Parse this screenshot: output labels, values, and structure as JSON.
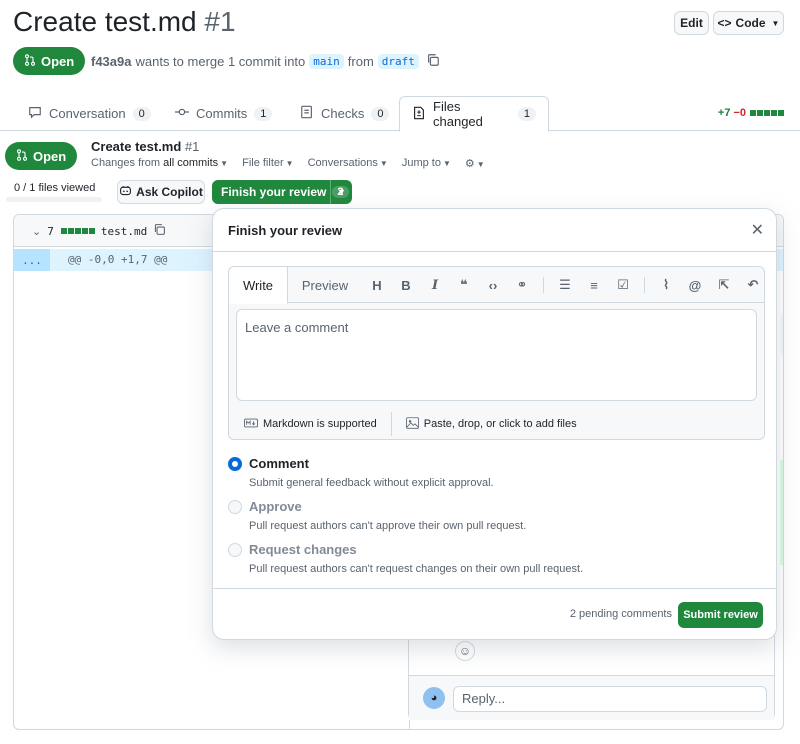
{
  "pr": {
    "title": "Create test.md",
    "number": "#1",
    "state": "Open",
    "author": "f43a9a",
    "merge_text": "wants to merge 1 commit into",
    "base_branch": "main",
    "from_text": "from",
    "head_branch": "draft"
  },
  "header_buttons": {
    "edit": "Edit",
    "code": "Code"
  },
  "tabs": [
    {
      "label": "Conversation",
      "count": "0"
    },
    {
      "label": "Commits",
      "count": "1"
    },
    {
      "label": "Checks",
      "count": "0"
    },
    {
      "label": "Files changed",
      "count": "1"
    }
  ],
  "diffstat": {
    "additions": "+7",
    "deletions": "−0"
  },
  "sticky": {
    "title": "Create test.md",
    "number": "#1",
    "changes_prefix": "Changes from",
    "changes_value": "all commits",
    "file_filter": "File filter",
    "conversations": "Conversations",
    "jump_to": "Jump to"
  },
  "files_viewed": "0 / 1 files viewed",
  "ask_copilot": "Ask Copilot",
  "finish_review": {
    "label": "Finish your review",
    "count": "2"
  },
  "file": {
    "lines": "7",
    "name": "test.md",
    "hunk": "@@ -0,0 +1,7 @@",
    "expand": "..."
  },
  "review": {
    "title": "Finish your review",
    "write_tab": "Write",
    "preview_tab": "Preview",
    "placeholder": "Leave a comment",
    "markdown_note": "Markdown is supported",
    "attach_note": "Paste, drop, or click to add files",
    "options": [
      {
        "label": "Comment",
        "desc": "Submit general feedback without explicit approval.",
        "checked": true,
        "disabled": false
      },
      {
        "label": "Approve",
        "desc": "Pull request authors can't approve their own pull request.",
        "checked": false,
        "disabled": true
      },
      {
        "label": "Request changes",
        "desc": "Pull request authors can't request changes on their own pull request.",
        "checked": false,
        "disabled": true
      }
    ],
    "pending": "2 pending comments",
    "submit": "Submit review"
  },
  "reply_placeholder": "Reply...",
  "colors": {
    "green": "#1f883d",
    "blue": "#0969da",
    "border": "#d1d9e0"
  }
}
